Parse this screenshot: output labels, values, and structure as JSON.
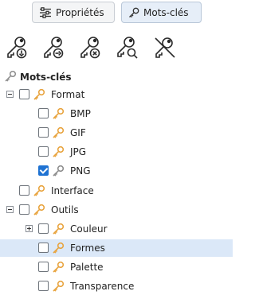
{
  "tabs": {
    "properties_label": "Propriétés",
    "keywords_label": "Mots-clés"
  },
  "toolbar": {
    "icons": [
      "key-import-icon",
      "key-export-icon",
      "key-remove-icon",
      "key-search-icon",
      "key-disabled-icon"
    ]
  },
  "tree": {
    "root_label": "Mots-clés",
    "format": {
      "label": "Format",
      "children": {
        "bmp": "BMP",
        "gif": "GIF",
        "jpg": "JPG",
        "png": "PNG"
      },
      "png_checked": true
    },
    "interface": {
      "label": "Interface"
    },
    "outils": {
      "label": "Outils",
      "children": {
        "couleur": "Couleur",
        "formes": "Formes",
        "palette": "Palette",
        "transparence": "Transparence"
      },
      "selected": "Formes"
    }
  },
  "colors": {
    "key_active": "#e8a33d",
    "key_inactive": "#8c8c8c",
    "selection": "#dbe8f8",
    "check": "#1e72d2"
  }
}
